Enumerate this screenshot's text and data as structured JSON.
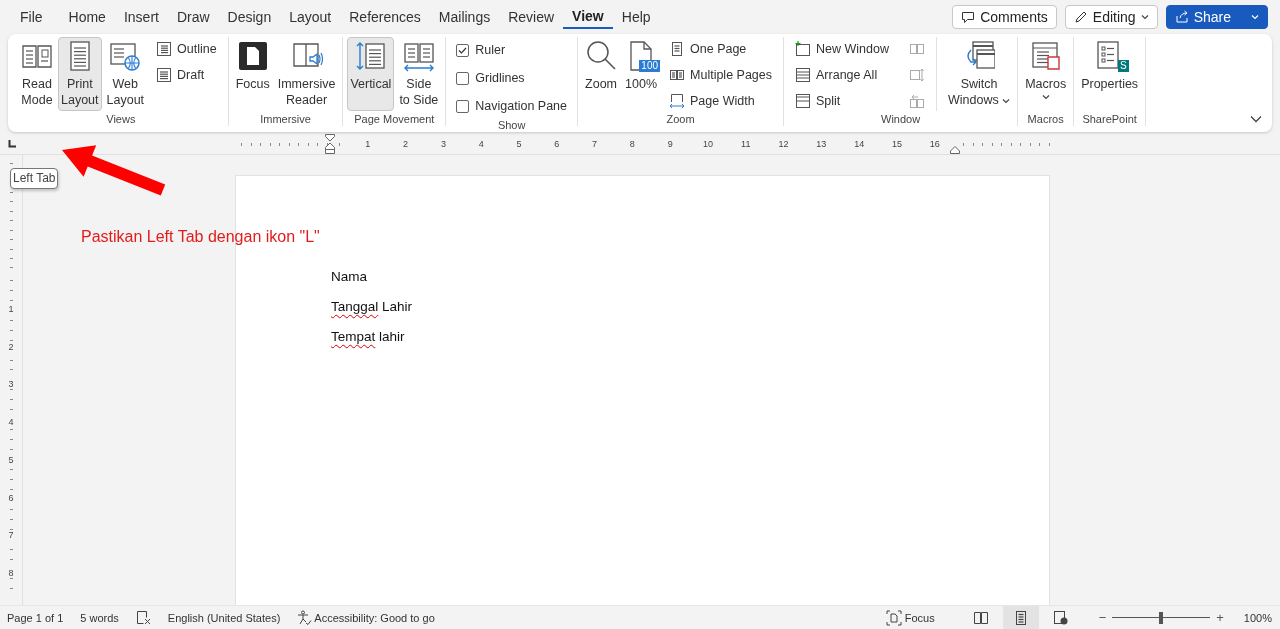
{
  "menu_tabs": [
    {
      "label": "File",
      "selected": false
    },
    {
      "label": "Home",
      "selected": false
    },
    {
      "label": "Insert",
      "selected": false
    },
    {
      "label": "Draw",
      "selected": false
    },
    {
      "label": "Design",
      "selected": false
    },
    {
      "label": "Layout",
      "selected": false
    },
    {
      "label": "References",
      "selected": false
    },
    {
      "label": "Mailings",
      "selected": false
    },
    {
      "label": "Review",
      "selected": false
    },
    {
      "label": "View",
      "selected": true
    },
    {
      "label": "Help",
      "selected": false
    }
  ],
  "header_buttons": [
    {
      "kind": "comments",
      "label": "Comments"
    },
    {
      "kind": "editing",
      "label": "Editing"
    },
    {
      "kind": "share",
      "label": "Share"
    }
  ],
  "ribbon": {
    "groups": [
      {
        "label": "Views",
        "items": [
          {
            "kind": "large",
            "label": "Read\nMode",
            "selected": false
          },
          {
            "kind": "large",
            "label": "Print\nLayout",
            "selected": true
          },
          {
            "kind": "large",
            "label": "Web\nLayout",
            "selected": false
          },
          {
            "kind": "small",
            "label": "Outline",
            "selected": false
          },
          {
            "kind": "small",
            "label": "Draft",
            "selected": false
          }
        ]
      },
      {
        "label": "Immersive",
        "items": [
          {
            "kind": "large",
            "label": "Focus"
          },
          {
            "kind": "large",
            "label": "Immersive\nReader"
          }
        ]
      },
      {
        "label": "Page Movement",
        "items": [
          {
            "kind": "large",
            "label": "Vertical",
            "selected": true
          },
          {
            "kind": "large",
            "label": "Side\nto Side",
            "selected": false
          }
        ]
      },
      {
        "label": "Show",
        "items": [
          {
            "kind": "check",
            "label": "Ruler",
            "checked": true
          },
          {
            "kind": "check",
            "label": "Gridlines",
            "checked": false
          },
          {
            "kind": "check",
            "label": "Navigation Pane",
            "checked": false
          }
        ]
      },
      {
        "label": "Zoom",
        "items": [
          {
            "kind": "large",
            "label": "Zoom"
          },
          {
            "kind": "large",
            "label": "100%",
            "badge": "100"
          },
          {
            "kind": "small",
            "label": "One Page"
          },
          {
            "kind": "small",
            "label": "Multiple Pages"
          },
          {
            "kind": "small",
            "label": "Page Width"
          }
        ]
      },
      {
        "label": "Window",
        "items": [
          {
            "kind": "small",
            "label": "New Window"
          },
          {
            "kind": "small",
            "label": "Arrange All"
          },
          {
            "kind": "small",
            "label": "Split"
          },
          {
            "kind": "mini",
            "disabled": true
          },
          {
            "kind": "mini",
            "disabled": true
          },
          {
            "kind": "mini",
            "disabled": true
          },
          {
            "kind": "large",
            "label": "Switch\nWindows",
            "dropdown": true
          }
        ]
      },
      {
        "label": "Macros",
        "items": [
          {
            "kind": "large",
            "label": "Macros",
            "dropdown": true
          }
        ]
      },
      {
        "label": "SharePoint",
        "items": [
          {
            "kind": "large",
            "label": "Properties",
            "badge": "S"
          }
        ]
      }
    ]
  },
  "ruler": {
    "horizontal": [
      "1",
      "2",
      "3",
      "4",
      "5",
      "6",
      "7",
      "8",
      "9",
      "10",
      "11",
      "12",
      "13",
      "14",
      "15",
      "16"
    ],
    "vertical": [
      "1",
      "2",
      "3",
      "4",
      "5",
      "6",
      "7",
      "8"
    ]
  },
  "tooltip": {
    "text": "Left Tab"
  },
  "annotation": {
    "text": "Pastikan Left Tab dengan ikon \"L\""
  },
  "document": {
    "lines": [
      {
        "parts": [
          {
            "text": "Nama",
            "misspelled": false
          }
        ]
      },
      {
        "parts": [
          {
            "text": "Tanggal",
            "misspelled": true
          },
          {
            "text": " Lahir",
            "misspelled": false
          }
        ]
      },
      {
        "parts": [
          {
            "text": "Tempat",
            "misspelled": true
          },
          {
            "text": " lahir",
            "misspelled": false
          }
        ]
      }
    ]
  },
  "status_bar": {
    "left": [
      {
        "kind": "text",
        "label": "Page 1 of 1"
      },
      {
        "kind": "text",
        "label": "5 words"
      },
      {
        "kind": "proofing"
      },
      {
        "kind": "text",
        "label": "English (United States)"
      },
      {
        "kind": "accessibility",
        "label": "Accessibility: Good to go"
      }
    ],
    "focus": "Focus",
    "views": [
      {
        "selected": false
      },
      {
        "selected": true
      },
      {
        "selected": false
      }
    ],
    "zoom": {
      "minus": "−",
      "plus": "+",
      "level": 0.5,
      "reading": "100%"
    }
  }
}
